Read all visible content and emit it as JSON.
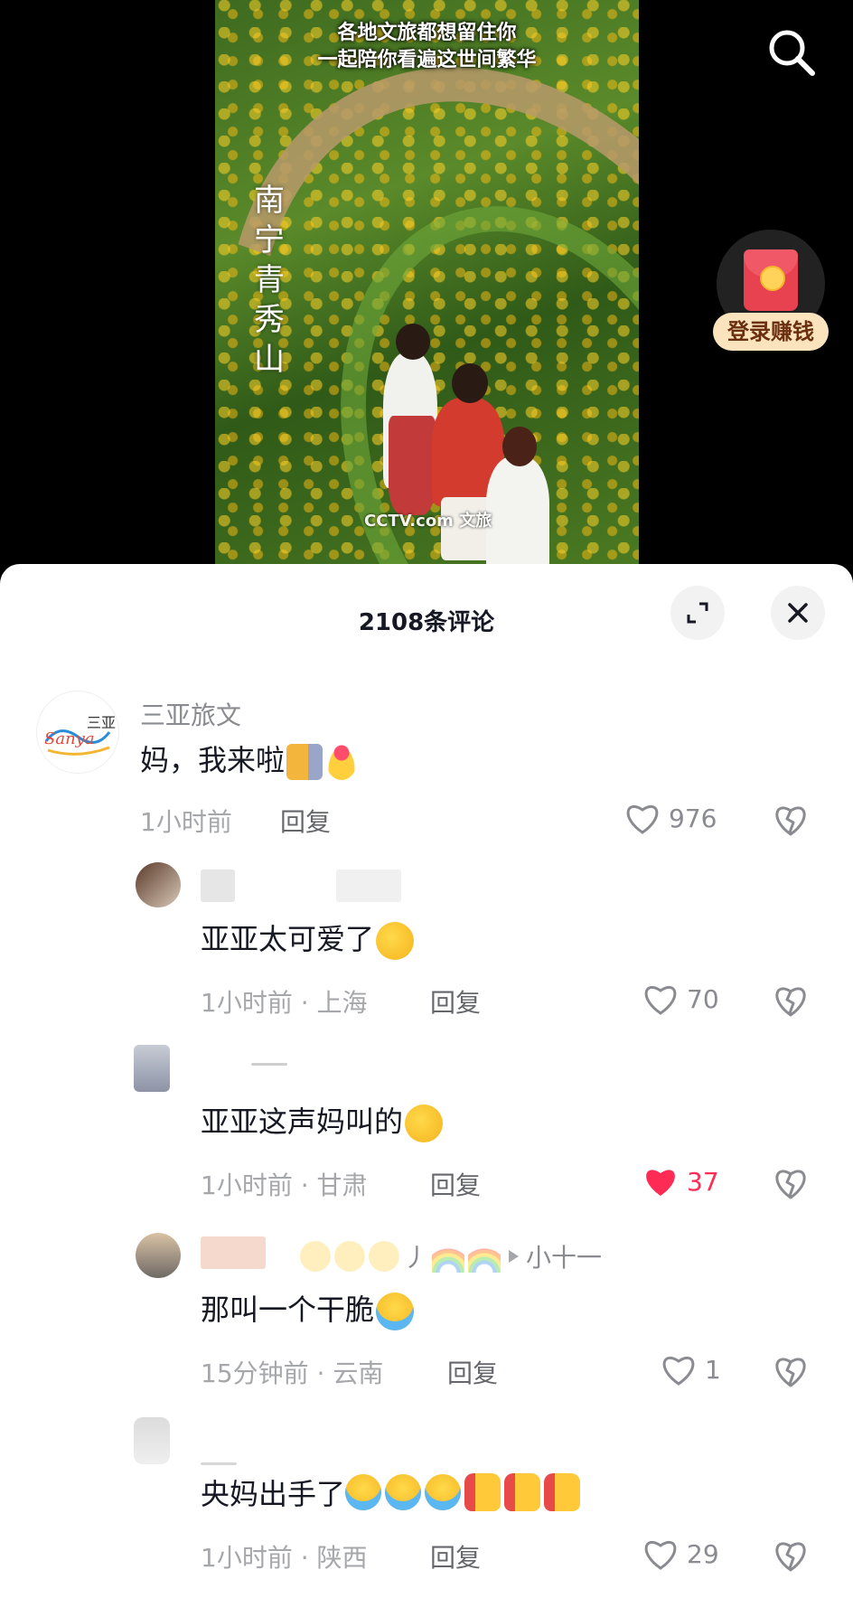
{
  "video": {
    "caption_line1": "各地文旅都想留住你",
    "caption_line2": "一起陪你看遍这世间繁华",
    "vertical_title": "南宁青秀山",
    "watermark": "CCTV.com 文旅"
  },
  "top_bar": {
    "search_icon": "search-icon",
    "red_packet_label": "登录赚钱"
  },
  "comments_panel": {
    "title": "2108条评论",
    "expand_icon": "expand-icon",
    "close_icon": "close-icon"
  },
  "comments": [
    {
      "username": "三亚旅文",
      "avatar_text": "Sanya 三亚",
      "text": "妈，我来啦",
      "emojis": [
        "cat-peek-emoji",
        "finger-heart-emoji"
      ],
      "time": "1小时前",
      "location": "",
      "reply_label": "回复",
      "likes": "976",
      "liked": false
    },
    {
      "username": "",
      "text": "亚亚太可爱了",
      "emojis": [
        "shy-face-emoji"
      ],
      "time": "1小时前",
      "location": "上海",
      "reply_label": "回复",
      "likes": "70",
      "liked": false
    },
    {
      "username": "",
      "text": "亚亚这声妈叫的",
      "emojis": [
        "shy-face-emoji"
      ],
      "time": "1小时前",
      "location": "甘肃",
      "reply_label": "回复",
      "likes": "37",
      "liked": true
    },
    {
      "username_suffix": "丿",
      "reply_to": "小十一",
      "text": "那叫一个干脆",
      "emojis": [
        "crying-face-emoji"
      ],
      "time": "15分钟前",
      "location": "云南",
      "reply_label": "回复",
      "likes": "1",
      "liked": false
    },
    {
      "username": "",
      "text": "央妈出手了",
      "emojis": [
        "crying-face-emoji",
        "crying-face-emoji",
        "crying-face-emoji",
        "thumbs-up-emoji",
        "thumbs-up-emoji",
        "thumbs-up-emoji"
      ],
      "time": "1小时前",
      "location": "陕西",
      "reply_label": "回复",
      "likes": "29",
      "liked": false
    }
  ],
  "meta_separator": " · ",
  "colors": {
    "like_active": "#fe2c55",
    "text_primary": "#161823",
    "text_secondary": "#8a8b91",
    "red_packet_label_bg": "#fbe4bd"
  }
}
